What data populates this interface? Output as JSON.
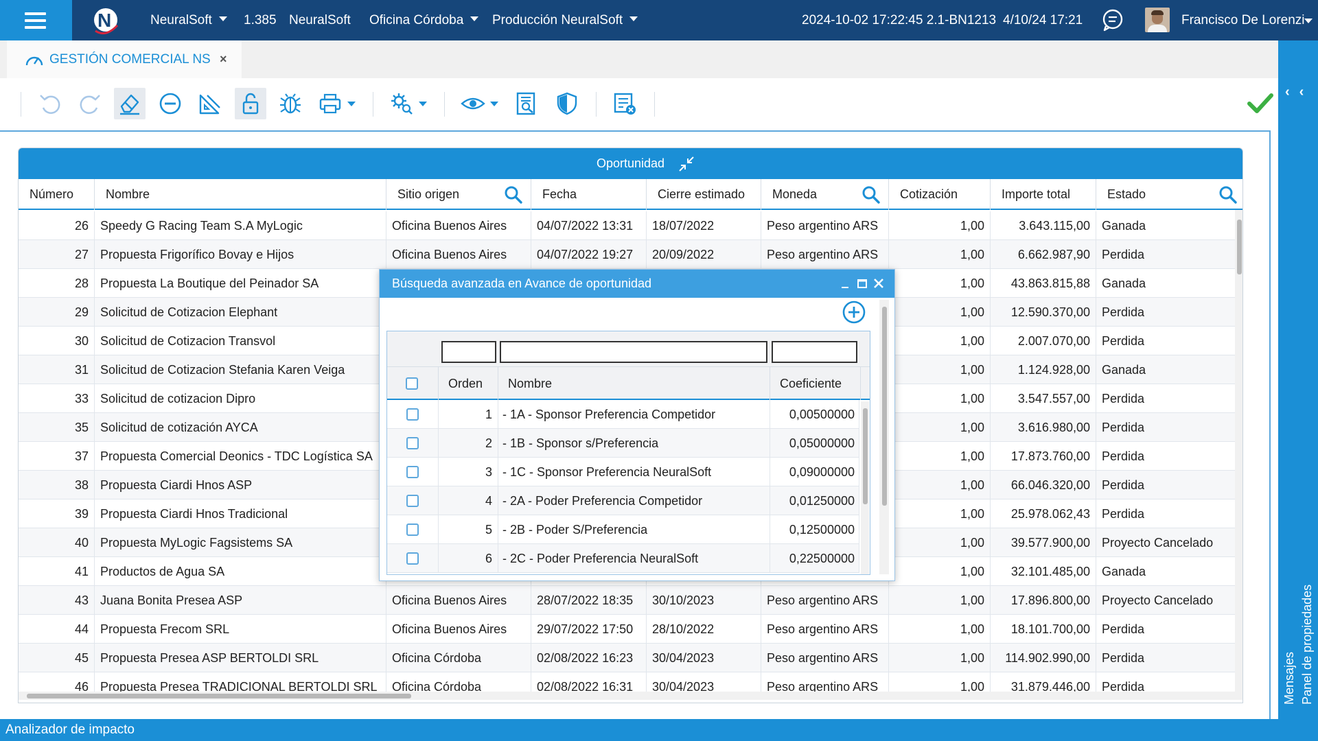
{
  "topbar": {
    "app_name": "NeuralSoft",
    "version": "1.385",
    "company": "NeuralSoft",
    "office": "Oficina Córdoba",
    "environment": "Producción NeuralSoft",
    "build": "2024-10-02 17:22:45 2.1-BN1213",
    "datetime": "4/10/24 17:21",
    "user": "Francisco De Lorenzi"
  },
  "tab": {
    "label": "GESTIÓN COMERCIAL NS",
    "close": "×"
  },
  "toolbar": {
    "buttons": [
      "undo-icon",
      "redo-icon",
      "eraser-icon",
      "remove-icon",
      "pencil-ruler-icon",
      "unlock-icon",
      "bug-icon",
      "print-icon",
      "settings-search-icon",
      "eye-icon",
      "report-search-icon",
      "shield-icon",
      "list-delete-icon"
    ],
    "confirm": "check-icon"
  },
  "colors": {
    "accent": "#1b8fd6",
    "topbar": "#16467a",
    "success": "#3cb043"
  },
  "grid": {
    "title": "Oportunidad",
    "columns": [
      "Número",
      "Nombre",
      "Sitio origen",
      "Fecha",
      "Cierre estimado",
      "Moneda",
      "Cotización",
      "Importe total",
      "Estado"
    ],
    "rows": [
      {
        "numero": "26",
        "nombre": "Speedy G Racing Team S.A MyLogic",
        "sitio": "Oficina Buenos Aires",
        "fecha": "04/07/2022 13:31",
        "cierre": "18/07/2022",
        "moneda": "Peso argentino ARS",
        "cotizacion": "1,00",
        "importe": "3.643.115,00",
        "estado": "Ganada"
      },
      {
        "numero": "27",
        "nombre": "Propuesta Frigorífico Bovay e Hijos",
        "sitio": "Oficina Buenos Aires",
        "fecha": "04/07/2022 19:27",
        "cierre": "20/09/2022",
        "moneda": "Peso argentino ARS",
        "cotizacion": "1,00",
        "importe": "6.662.987,90",
        "estado": "Perdida"
      },
      {
        "numero": "28",
        "nombre": "Propuesta La Boutique del Peinador SA",
        "sitio": "",
        "fecha": "",
        "cierre": "",
        "moneda": "",
        "cotizacion": "1,00",
        "importe": "43.863.815,88",
        "estado": "Ganada"
      },
      {
        "numero": "29",
        "nombre": "Solicitud de Cotizacion Elephant",
        "sitio": "",
        "fecha": "",
        "cierre": "",
        "moneda": "",
        "cotizacion": "1,00",
        "importe": "12.590.370,00",
        "estado": "Perdida"
      },
      {
        "numero": "30",
        "nombre": "Solicitud de Cotizacion Transvol",
        "sitio": "",
        "fecha": "",
        "cierre": "",
        "moneda": "",
        "cotizacion": "1,00",
        "importe": "2.007.070,00",
        "estado": "Perdida"
      },
      {
        "numero": "31",
        "nombre": "Solicitud de Cotizacion Stefania Karen Veiga",
        "sitio": "",
        "fecha": "",
        "cierre": "",
        "moneda": "",
        "cotizacion": "1,00",
        "importe": "1.124.928,00",
        "estado": "Ganada"
      },
      {
        "numero": "33",
        "nombre": "Solicitud de cotizacion Dipro",
        "sitio": "",
        "fecha": "",
        "cierre": "",
        "moneda": "",
        "cotizacion": "1,00",
        "importe": "3.547.557,00",
        "estado": "Perdida"
      },
      {
        "numero": "35",
        "nombre": "Solicitud de cotización AYCA",
        "sitio": "",
        "fecha": "",
        "cierre": "",
        "moneda": "",
        "cotizacion": "1,00",
        "importe": "3.616.980,00",
        "estado": "Perdida"
      },
      {
        "numero": "37",
        "nombre": "Propuesta Comercial Deonics - TDC Logística SA",
        "sitio": "",
        "fecha": "",
        "cierre": "",
        "moneda": "",
        "cotizacion": "1,00",
        "importe": "17.873.760,00",
        "estado": "Perdida"
      },
      {
        "numero": "38",
        "nombre": "Propuesta Ciardi Hnos ASP",
        "sitio": "",
        "fecha": "",
        "cierre": "",
        "moneda": "",
        "cotizacion": "1,00",
        "importe": "66.046.320,00",
        "estado": "Perdida"
      },
      {
        "numero": "39",
        "nombre": "Propuesta Ciardi Hnos Tradicional",
        "sitio": "",
        "fecha": "",
        "cierre": "",
        "moneda": "",
        "cotizacion": "1,00",
        "importe": "25.978.062,43",
        "estado": "Perdida"
      },
      {
        "numero": "40",
        "nombre": "Propuesta MyLogic Fagsistems SA",
        "sitio": "",
        "fecha": "",
        "cierre": "",
        "moneda": "",
        "cotizacion": "1,00",
        "importe": "39.577.900,00",
        "estado": "Proyecto Cancelado"
      },
      {
        "numero": "41",
        "nombre": "Productos de Agua SA",
        "sitio": "",
        "fecha": "",
        "cierre": "",
        "moneda": "",
        "cotizacion": "1,00",
        "importe": "32.101.485,00",
        "estado": "Ganada"
      },
      {
        "numero": "43",
        "nombre": "Juana Bonita Presea ASP",
        "sitio": "Oficina Buenos Aires",
        "fecha": "28/07/2022 18:35",
        "cierre": "30/10/2023",
        "moneda": "Peso argentino ARS",
        "cotizacion": "1,00",
        "importe": "17.896.800,00",
        "estado": "Proyecto Cancelado"
      },
      {
        "numero": "44",
        "nombre": "Propuesta Frecom SRL",
        "sitio": "Oficina Buenos Aires",
        "fecha": "29/07/2022 17:50",
        "cierre": "28/10/2022",
        "moneda": "Peso argentino ARS",
        "cotizacion": "1,00",
        "importe": "18.101.700,00",
        "estado": "Perdida"
      },
      {
        "numero": "45",
        "nombre": "Propuesta Presea ASP BERTOLDI SRL",
        "sitio": "Oficina Córdoba",
        "fecha": "02/08/2022 16:23",
        "cierre": "30/04/2023",
        "moneda": "Peso argentino ARS",
        "cotizacion": "1,00",
        "importe": "114.902.990,00",
        "estado": "Perdida"
      },
      {
        "numero": "46",
        "nombre": "Propuesta Presea TRADICIONAL BERTOLDI SRL",
        "sitio": "Oficina Córdoba",
        "fecha": "02/08/2022 16:31",
        "cierre": "30/04/2023",
        "moneda": "Peso argentino ARS",
        "cotizacion": "1,00",
        "importe": "31.879.446,00",
        "estado": "Perdida"
      }
    ]
  },
  "dialog": {
    "title": "Búsqueda avanzada en Avance de oportunidad",
    "columns": [
      "Orden",
      "Nombre",
      "Coeficiente"
    ],
    "rows": [
      {
        "orden": "1",
        "nombre": "- 1A - Sponsor Preferencia Competidor",
        "coeficiente": "0,00500000"
      },
      {
        "orden": "2",
        "nombre": "- 1B - Sponsor s/Preferencia",
        "coeficiente": "0,05000000"
      },
      {
        "orden": "3",
        "nombre": "- 1C - Sponsor Preferencia NeuralSoft",
        "coeficiente": "0,09000000"
      },
      {
        "orden": "4",
        "nombre": "- 2A - Poder Preferencia Competidor",
        "coeficiente": "0,01250000"
      },
      {
        "orden": "5",
        "nombre": "- 2B - Poder S/Preferencia",
        "coeficiente": "0,12500000"
      },
      {
        "orden": "6",
        "nombre": "- 2C - Poder Preferencia NeuralSoft",
        "coeficiente": "0,22500000"
      }
    ]
  },
  "right_panel": {
    "messages": "Mensajes",
    "properties": "Panel de propiedades"
  },
  "bottombar": {
    "label": "Analizador de impacto"
  }
}
